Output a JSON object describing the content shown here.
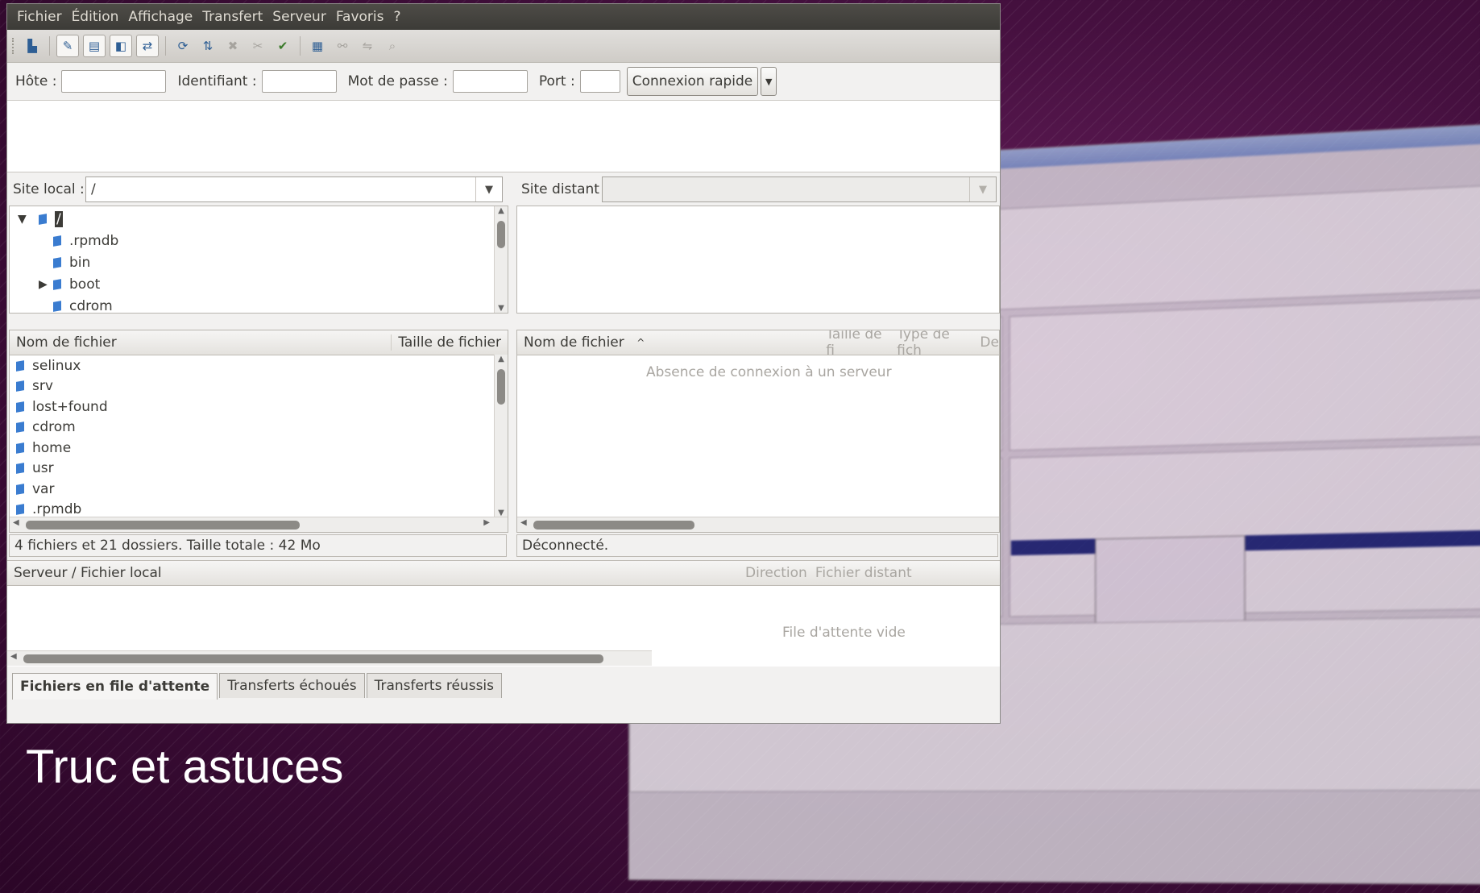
{
  "slide": {
    "title": "Truc et astuces"
  },
  "menu": [
    "Fichier",
    "Édition",
    "Affichage",
    "Transfert",
    "Serveur",
    "Favoris",
    "?"
  ],
  "toolbar_icons": [
    "site-manager-icon",
    "message-log-toggle-icon",
    "local-tree-toggle-icon",
    "remote-tree-toggle-icon",
    "transfer-queue-toggle-icon",
    "refresh-icon",
    "process-queue-icon",
    "cancel-icon",
    "disconnect-icon",
    "reconnect-icon",
    "filter-icon",
    "compare-icon",
    "sync-browse-icon",
    "search-icon"
  ],
  "quickconnect": {
    "host_label": "Hôte :",
    "user_label": "Identifiant :",
    "pass_label": "Mot de passe :",
    "port_label": "Port :",
    "connect_label": "Connexion rapide"
  },
  "local": {
    "site_label": "Site local :",
    "path": "/",
    "tree": [
      {
        "label": "/",
        "expanded": true,
        "level": 0
      },
      {
        "label": ".rpmdb",
        "level": 1
      },
      {
        "label": "bin",
        "level": 1
      },
      {
        "label": "boot",
        "level": 1,
        "collapsed": true
      },
      {
        "label": "cdrom",
        "level": 1
      }
    ],
    "columns": {
      "name": "Nom de fichier",
      "size": "Taille de fichier"
    },
    "files": [
      "selinux",
      "srv",
      "lost+found",
      "cdrom",
      "home",
      "usr",
      "var",
      ".rpmdb"
    ],
    "status": "4 fichiers et 21 dossiers. Taille totale : 42 Mo"
  },
  "remote": {
    "site_label": "Site distant :",
    "columns": {
      "name": "Nom de fichier",
      "size": "Taille de fi",
      "type": "Type de fich",
      "date": "De"
    },
    "empty_message": "Absence de connexion à un serveur",
    "status": "Déconnecté."
  },
  "queue": {
    "columns": {
      "server": "Serveur / Fichier local",
      "direction": "Direction",
      "remote": "Fichier distant"
    },
    "empty_message": "File d'attente vide",
    "tabs": [
      "Fichiers en file d'attente",
      "Transferts échoués",
      "Transferts réussis"
    ]
  },
  "colors": {
    "desktop": "#3a0a33",
    "menubar": "#3c3b37",
    "folder": "#3a7cd0",
    "selection": "#3c3b37"
  }
}
